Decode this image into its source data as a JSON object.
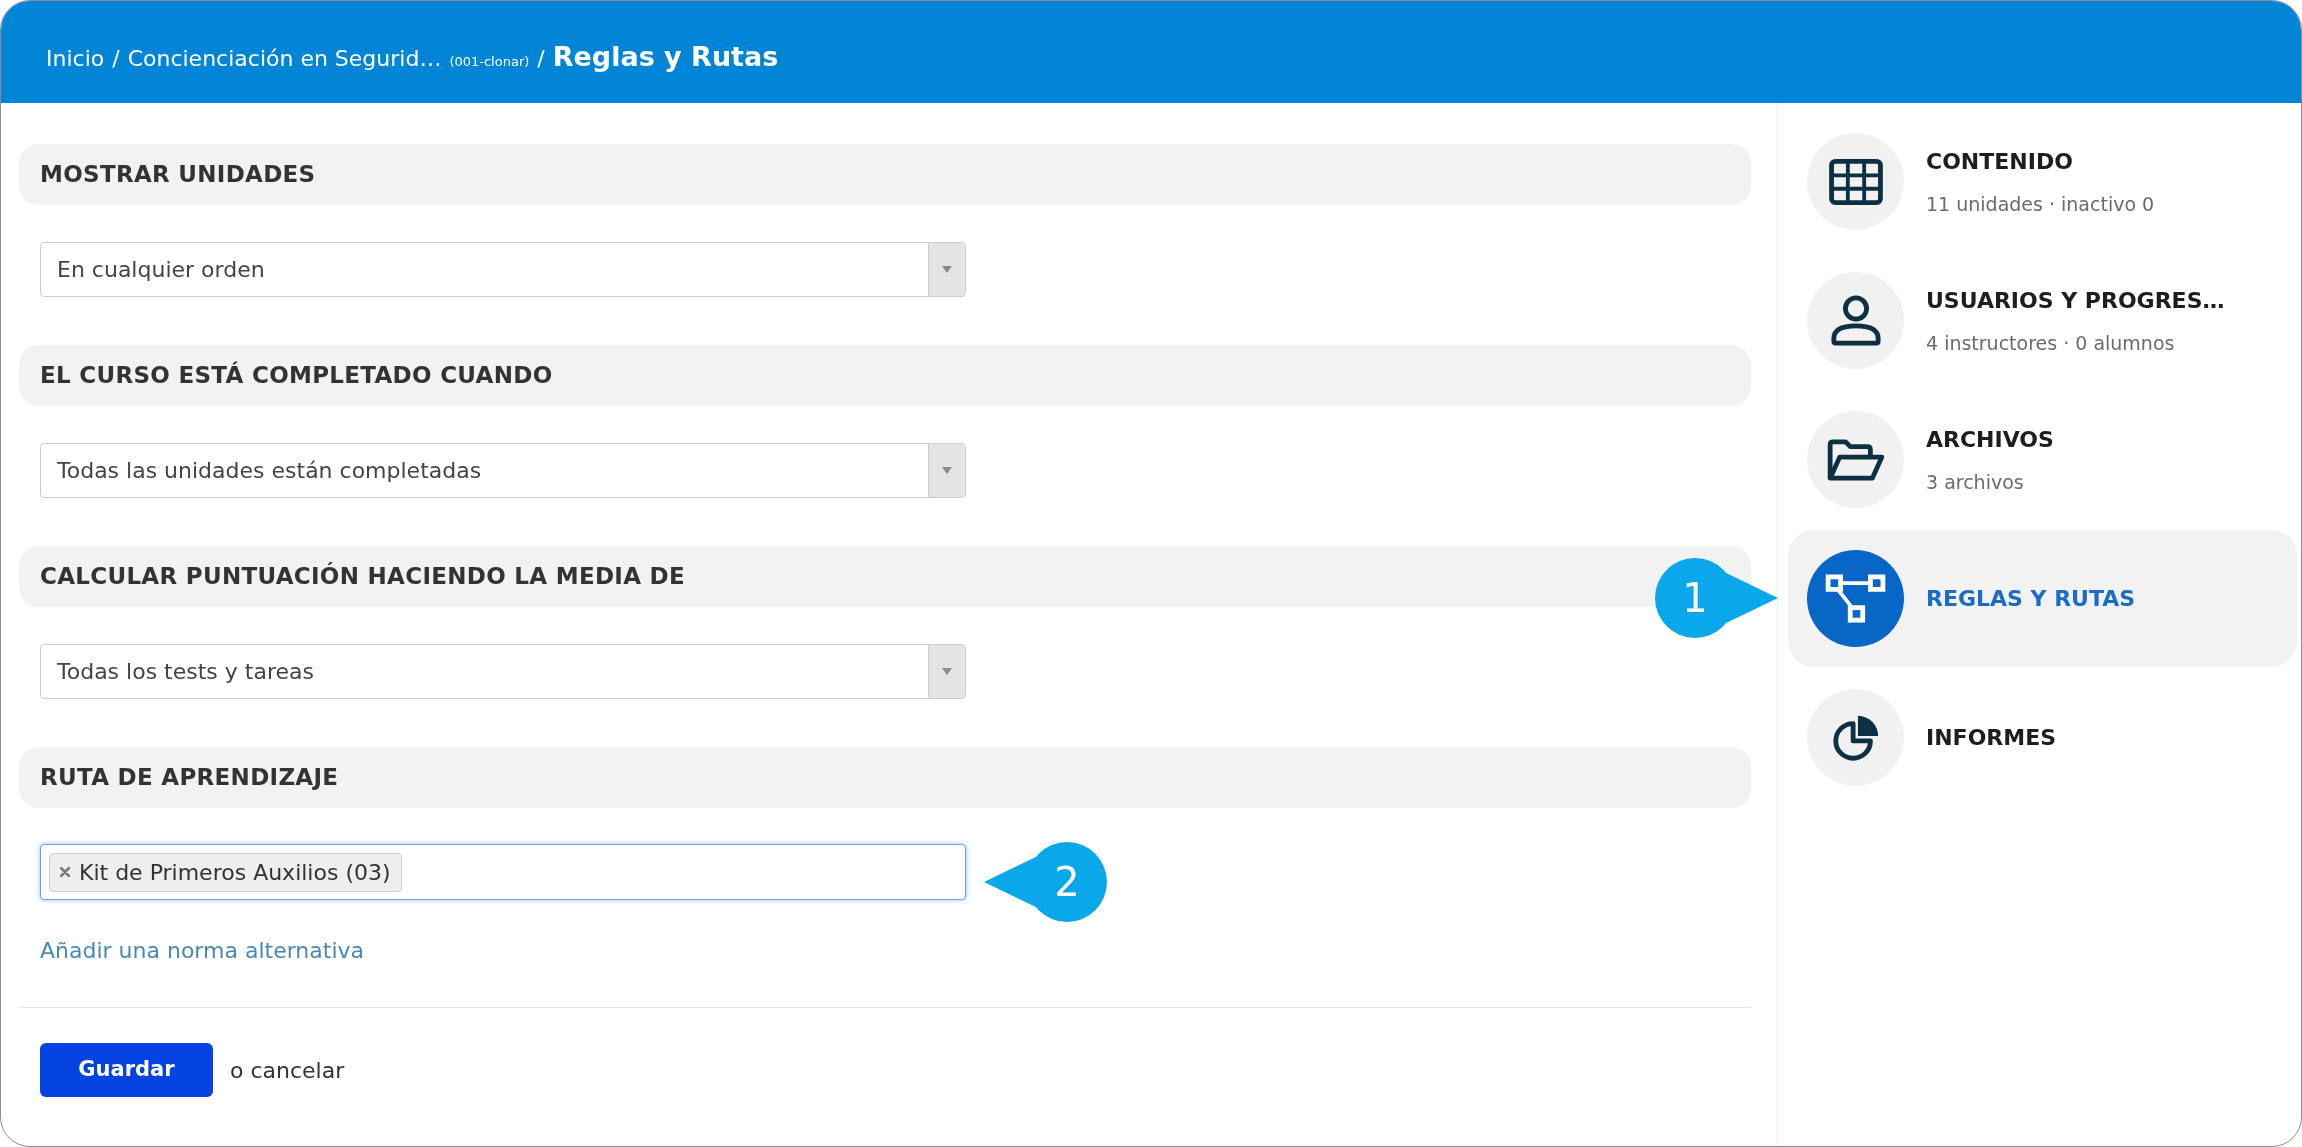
{
  "breadcrumb": [
    {
      "kind": "link",
      "label": "Inicio"
    },
    {
      "kind": "separator",
      "label": "/"
    },
    {
      "kind": "link",
      "label": "Concienciación en Segurid…"
    },
    {
      "kind": "note",
      "label": "(001-clonar)"
    },
    {
      "kind": "separator",
      "label": "/"
    },
    {
      "kind": "current",
      "label": "Reglas y Rutas"
    }
  ],
  "sections": [
    {
      "title": "MOSTRAR UNIDADES",
      "kind": "select",
      "value": "En cualquier orden"
    },
    {
      "title": "EL CURSO ESTÁ COMPLETADO CUANDO",
      "kind": "select",
      "value": "Todas las unidades están completadas"
    },
    {
      "title": "CALCULAR PUNTUACIÓN HACIENDO LA MEDIA DE",
      "kind": "select",
      "value": "Todas los tests y tareas"
    },
    {
      "title": "RUTA DE APRENDIZAJE",
      "kind": "tags",
      "focused": true,
      "tags": [
        "Kit de Primeros Auxilios (03)"
      ],
      "link": "Añadir una norma alternativa"
    }
  ],
  "actions": {
    "save": "Guardar",
    "cancel": "o cancelar"
  },
  "sidebar": {
    "items": [
      {
        "title": "CONTENIDO",
        "subtitle": "11 unidades · inactivo 0",
        "selected": false
      },
      {
        "title": "USUARIOS Y PROGRES…",
        "subtitle": "4 instructores · 0 alumnos",
        "selected": false
      },
      {
        "title": "ARCHIVOS",
        "subtitle": "3 archivos",
        "selected": false
      },
      {
        "title": "REGLAS Y RUTAS",
        "selected": true
      },
      {
        "title": "INFORMES",
        "selected": false
      }
    ]
  },
  "callouts": [
    {
      "label": "1"
    },
    {
      "label": "2"
    }
  ]
}
